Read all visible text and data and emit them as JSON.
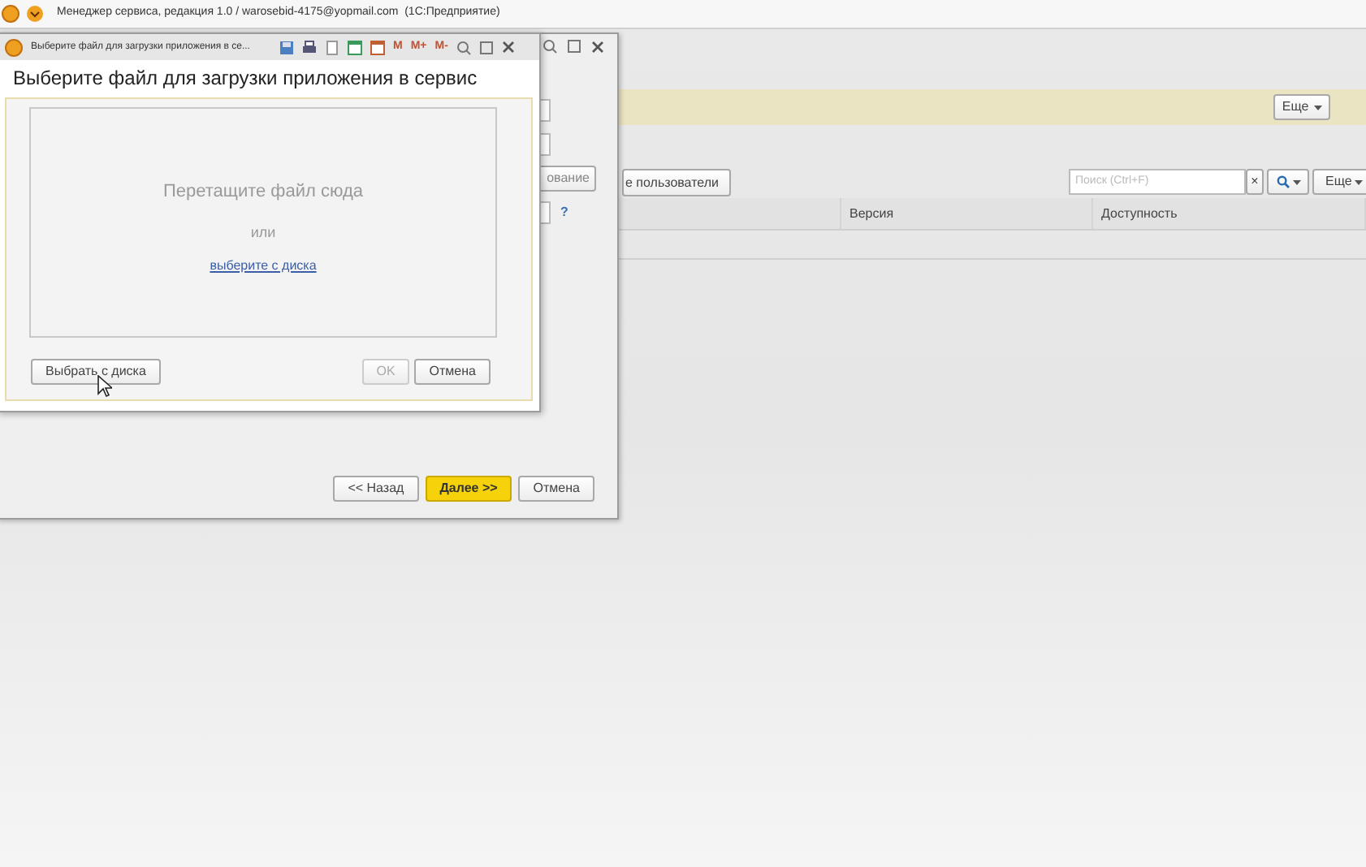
{
  "app_title": "Менеджер сервиса, редакция 1.0 / warosebid-4175@yopmail.com  (1С:Предприятие)",
  "main": {
    "more_button": "Еще",
    "users_button": "е пользователи",
    "search": {
      "placeholder": "Поиск (Ctrl+F)"
    },
    "clear_button": "×",
    "more_button_2": "Еще",
    "table": {
      "columns": [
        "Версия",
        "Доступность"
      ]
    }
  },
  "wizard": {
    "partial_button": "ование",
    "help": "?",
    "buttons": [
      {
        "label": "<< Назад",
        "default": false
      },
      {
        "label": "Далее >>",
        "default": true
      },
      {
        "label": "Отмена",
        "default": false
      }
    ]
  },
  "dialog": {
    "window_title": "Выберите файл для загрузки приложения в се...",
    "memory_buttons": [
      "M",
      "M+",
      "M-"
    ],
    "heading": "Выберите файл для загрузки приложения в сервис",
    "drop_text": "Перетащите файл сюда",
    "or": "или",
    "link": "выберите с диска",
    "buttons": [
      {
        "label": "Выбрать с диска",
        "disabled": false
      },
      {
        "label": "OK",
        "disabled": true
      },
      {
        "label": "Отмена",
        "disabled": false
      }
    ]
  }
}
